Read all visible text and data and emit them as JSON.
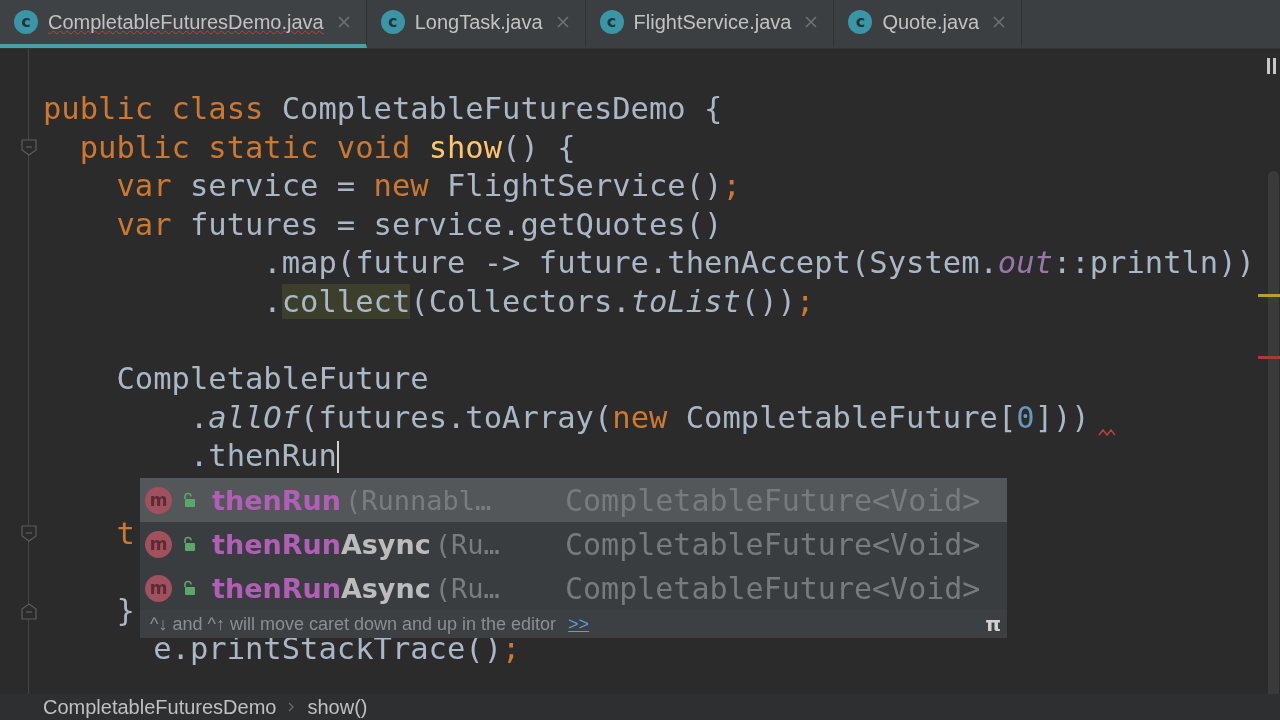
{
  "tabs": [
    {
      "label": "CompletableFuturesDemo.java",
      "icon": "c",
      "selected": true,
      "has_error": true
    },
    {
      "label": "LongTask.java",
      "icon": "c",
      "selected": false,
      "has_error": false
    },
    {
      "label": "FlightService.java",
      "icon": "c",
      "selected": false,
      "has_error": false
    },
    {
      "label": "Quote.java",
      "icon": "c",
      "selected": false,
      "has_error": false
    }
  ],
  "editor": {
    "lines": [
      {
        "kind": "code",
        "tokens": [
          {
            "kind": "keyword",
            "text": "public class "
          },
          {
            "kind": "plain",
            "text": "CompletableFuturesDemo {"
          }
        ]
      },
      {
        "kind": "code",
        "fold_open": true,
        "tokens": [
          {
            "kind": "keyword",
            "text": "  public static void "
          },
          {
            "kind": "decl",
            "text": "show"
          },
          {
            "kind": "plain",
            "text": "() {"
          }
        ]
      },
      {
        "kind": "code",
        "tokens": [
          {
            "kind": "keyword",
            "text": "    var "
          },
          {
            "kind": "plain",
            "text": "service = "
          },
          {
            "kind": "keyword",
            "text": "new "
          },
          {
            "kind": "plain",
            "text": "FlightService()"
          },
          {
            "kind": "keyword",
            "text": ";"
          }
        ]
      },
      {
        "kind": "code",
        "tokens": [
          {
            "kind": "keyword",
            "text": "    var "
          },
          {
            "kind": "plain",
            "text": "futures = service.getQuotes()"
          }
        ]
      },
      {
        "kind": "code",
        "tokens": [
          {
            "kind": "plain",
            "text": "            .map(future -> future.thenAccept(System."
          },
          {
            "kind": "field",
            "text": "out"
          },
          {
            "kind": "plain",
            "text": "::println))"
          }
        ]
      },
      {
        "kind": "code",
        "tokens": [
          {
            "kind": "plain",
            "text": "            ."
          },
          {
            "kind": "warn",
            "text": "collect"
          },
          {
            "kind": "plain",
            "text": "(Collectors."
          },
          {
            "kind": "static",
            "text": "toList"
          },
          {
            "kind": "plain",
            "text": "())"
          },
          {
            "kind": "keyword",
            "text": ";"
          }
        ]
      },
      {
        "kind": "blank"
      },
      {
        "kind": "code",
        "tokens": [
          {
            "kind": "plain",
            "text": "    CompletableFuture"
          }
        ]
      },
      {
        "kind": "code",
        "error": true,
        "tokens": [
          {
            "kind": "plain",
            "text": "        ."
          },
          {
            "kind": "static",
            "text": "allOf"
          },
          {
            "kind": "plain",
            "text": "(futures.toArray("
          },
          {
            "kind": "keyword",
            "text": "new "
          },
          {
            "kind": "plain",
            "text": "CompletableFuture["
          },
          {
            "kind": "number",
            "text": "0"
          },
          {
            "kind": "plain",
            "text": "]))"
          }
        ]
      },
      {
        "kind": "code",
        "caret": true,
        "tokens": [
          {
            "kind": "plain",
            "text": "        .thenRun"
          }
        ]
      },
      {
        "kind": "blank"
      },
      {
        "kind": "code",
        "fold_open": true,
        "tokens": [
          {
            "kind": "keyword",
            "text": "    t"
          }
        ]
      },
      {
        "kind": "blank"
      },
      {
        "kind": "code",
        "fold_close": true,
        "tokens": [
          {
            "kind": "plain",
            "text": "    }"
          }
        ]
      },
      {
        "kind": "code",
        "tokens": [
          {
            "kind": "plain",
            "text": "      e.printStackTrace()"
          },
          {
            "kind": "keyword",
            "text": ";"
          }
        ]
      }
    ],
    "completion": {
      "items": [
        {
          "icon": "m",
          "match": "thenRun",
          "params": "(Runnabl…",
          "type": "CompletableFuture<Void>",
          "selected": true
        },
        {
          "icon": "m",
          "match": "thenRun",
          "rest": "Async",
          "params": "(Ru…",
          "type": "CompletableFuture<Void>",
          "selected": false
        },
        {
          "icon": "m",
          "match": "thenRun",
          "rest": "Async",
          "params": "(Ru…",
          "type": "CompletableFuture<Void>",
          "selected": false
        }
      ],
      "hint": "^↓ and ^↑ will move caret down and up in the editor",
      "hint_link": ">>",
      "corner": "π"
    }
  },
  "breadcrumbs": [
    "CompletableFuturesDemo",
    "show()"
  ]
}
